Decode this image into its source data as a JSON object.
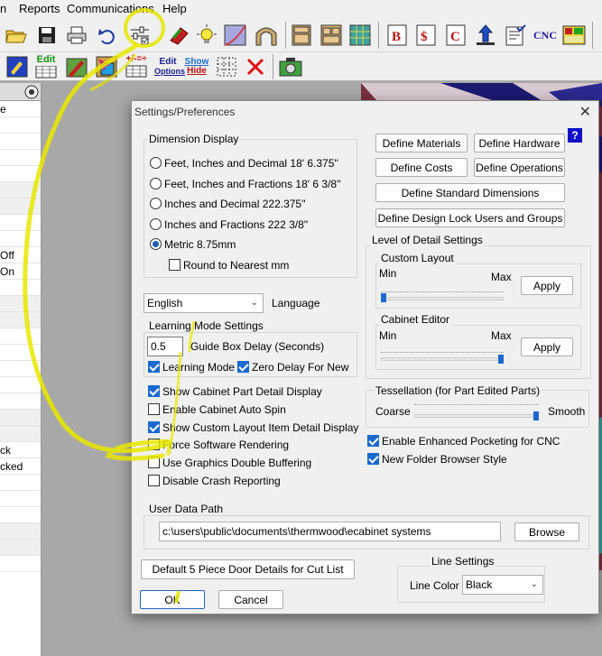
{
  "menu": [
    "n",
    "Reports",
    "Communications",
    "Help"
  ],
  "toolbar": {
    "cnc_label": "CNC",
    "edit_label_line1": "Edit",
    "edit_label_line2": "Table",
    "edit_options_line1": "Edit",
    "edit_options_line2": "Options",
    "show_hide_line1": "Show",
    "show_hide_line2": "Hide",
    "operators_label": "+/-=÷"
  },
  "left_panel": {
    "rows": [
      "e",
      "",
      "",
      "",
      "",
      "",
      "",
      "",
      "",
      "Off",
      "On",
      "",
      "",
      "",
      "",
      "",
      "",
      "",
      "",
      "",
      "",
      "ck",
      "cked",
      "",
      "",
      "",
      "",
      "",
      ""
    ]
  },
  "dialog": {
    "title": "Settings/Preferences",
    "close_glyph": "✕",
    "help_glyph": "?",
    "dimension_display": {
      "label": "Dimension Display",
      "options": [
        {
          "label": "Feet, Inches and Decimal 18' 6.375''",
          "selected": false
        },
        {
          "label": "Feet, Inches and Fractions 18' 6 3/8''",
          "selected": false
        },
        {
          "label": "Inches and Decimal 222.375''",
          "selected": false
        },
        {
          "label": "Inches and Fractions 222 3/8''",
          "selected": false
        },
        {
          "label": "Metric 8.75mm",
          "selected": true
        }
      ],
      "round_label": "Round to Nearest mm",
      "round_checked": false
    },
    "language": {
      "value": "English",
      "label": "Language"
    },
    "learning_mode": {
      "label": "Learning Mode Settings",
      "guide_delay_value": "0.5",
      "guide_delay_label": "Guide Box Delay (Seconds)",
      "learning_mode_label": "Learning Mode",
      "learning_mode_checked": true,
      "zero_delay_label": "Zero Delay For New",
      "zero_delay_checked": true
    },
    "options": [
      {
        "label": "Show Cabinet Part Detail Display",
        "checked": true
      },
      {
        "label": "Enable Cabinet Auto Spin",
        "checked": false
      },
      {
        "label": "Show Custom Layout Item Detail Display",
        "checked": true
      },
      {
        "label": "Force Software Rendering",
        "checked": false
      },
      {
        "label": "Use Graphics Double Buffering",
        "checked": false
      },
      {
        "label": "Disable Crash Reporting",
        "checked": false
      }
    ],
    "buttons": {
      "define_materials": "Define Materials",
      "define_hardware": "Define Hardware",
      "define_costs": "Define Costs",
      "define_operations": "Define Operations",
      "define_standard_dimensions": "Define Standard Dimensions",
      "define_design_lock": "Define Design Lock Users and Groups",
      "apply": "Apply",
      "browse": "Browse",
      "default_door": "Default 5 Piece Door Details for Cut List",
      "ok": "OK",
      "cancel": "Cancel"
    },
    "level_of_detail": {
      "label": "Level of Detail Settings",
      "custom_layout": {
        "label": "Custom Layout",
        "min": "Min",
        "max": "Max",
        "level": 0.0
      },
      "cabinet_editor": {
        "label": "Cabinet Editor",
        "min": "Min",
        "max": "Max",
        "level": 1.0
      }
    },
    "tessellation": {
      "label": "Tessellation (for Part Edited Parts)",
      "coarse": "Coarse",
      "smooth": "Smooth",
      "level": 1.0
    },
    "right_options": [
      {
        "label": "Enable Enhanced Pocketing for CNC",
        "checked": true
      },
      {
        "label": "New Folder Browser Style",
        "checked": true
      }
    ],
    "user_data_path": {
      "label": "User Data Path",
      "value": "c:\\users\\public\\documents\\thermwood\\ecabinet systems"
    },
    "line_settings": {
      "label": "Line Settings",
      "color_label": "Line Color",
      "color_value": "Black"
    }
  },
  "colors": {
    "annotation": "#e8e800",
    "accent": "#1a6ad0",
    "canvas": "#a8a8a8"
  }
}
